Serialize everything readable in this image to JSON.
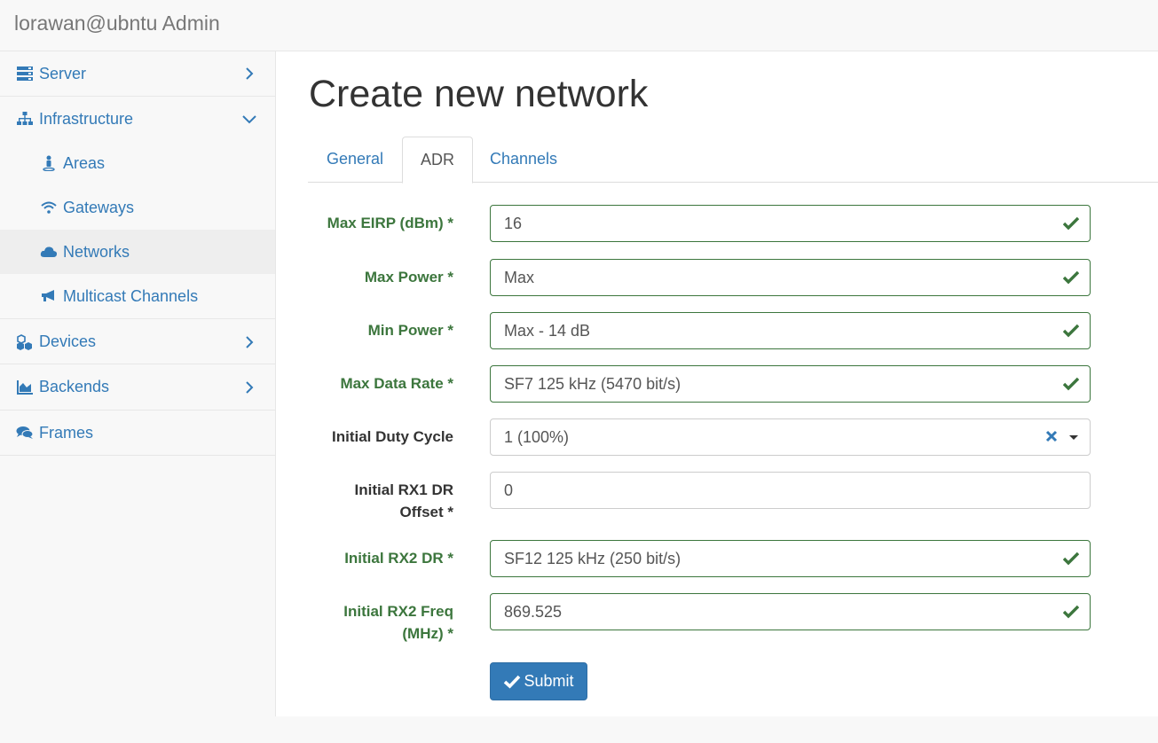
{
  "app": {
    "brand": "lorawan@ubntu Admin"
  },
  "sidebar": {
    "server": "Server",
    "infrastructure": "Infrastructure",
    "areas": "Areas",
    "gateways": "Gateways",
    "networks": "Networks",
    "multicast": "Multicast Channels",
    "devices": "Devices",
    "backends": "Backends",
    "frames": "Frames"
  },
  "page": {
    "title": "Create new network"
  },
  "tabs": {
    "general": "General",
    "adr": "ADR",
    "channels": "Channels",
    "active": "ADR"
  },
  "form": {
    "max_eirp": {
      "label": "Max EIRP (dBm) *",
      "value": "16"
    },
    "max_power": {
      "label": "Max Power *",
      "value": "Max"
    },
    "min_power": {
      "label": "Min Power *",
      "value": "Max - 14 dB"
    },
    "max_data_rate": {
      "label": "Max Data Rate *",
      "value": "SF7 125 kHz (5470 bit/s)"
    },
    "initial_duty_cycle": {
      "label": "Initial Duty Cycle",
      "value": "1 (100%)"
    },
    "initial_rx1_dr_offset": {
      "label_line1": "Initial RX1 DR",
      "label_line2": "Offset *",
      "value": "0"
    },
    "initial_rx2_dr": {
      "label": "Initial RX2 DR *",
      "value": "SF12 125 kHz (250 bit/s)"
    },
    "initial_rx2_freq": {
      "label_line1": "Initial RX2 Freq",
      "label_line2": "(MHz) *",
      "value": "869.525"
    },
    "submit": "Submit"
  },
  "colors": {
    "link": "#337ab7",
    "success": "#3c763d",
    "primary": "#337ab7"
  }
}
